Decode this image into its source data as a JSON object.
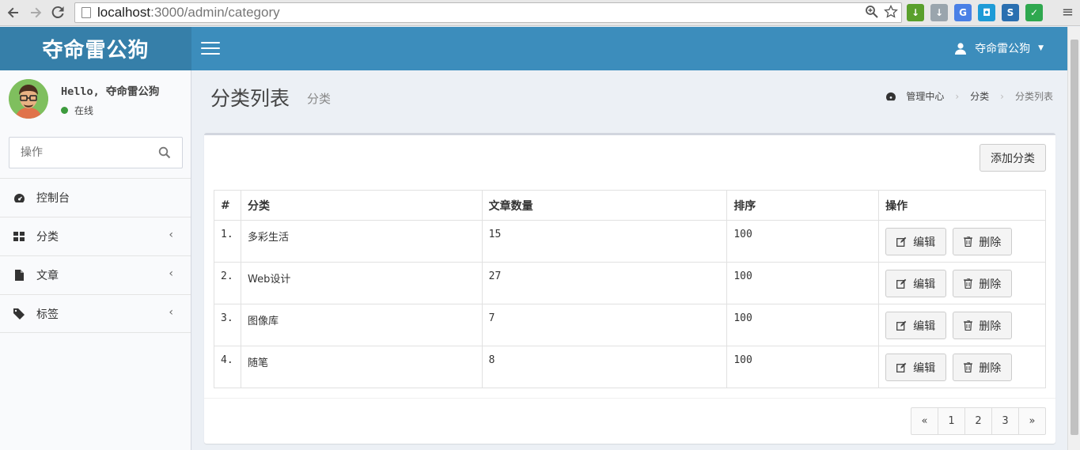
{
  "browser": {
    "url_host": "localhost",
    "url_rest": ":3000/admin/category"
  },
  "app": {
    "logo": "夺命雷公狗",
    "user_name": "夺命雷公狗"
  },
  "sidebar": {
    "hello": "Hello, 夺命雷公狗",
    "status": "在线",
    "search_placeholder": "操作",
    "items": [
      {
        "label": "控制台",
        "icon": "dashboard-icon",
        "has_children": false
      },
      {
        "label": "分类",
        "icon": "grid-icon",
        "has_children": true
      },
      {
        "label": "文章",
        "icon": "file-icon",
        "has_children": true
      },
      {
        "label": "标签",
        "icon": "tag-icon",
        "has_children": true
      }
    ]
  },
  "header": {
    "title": "分类列表",
    "subtitle": "分类",
    "breadcrumb": [
      "管理中心",
      "分类",
      "分类列表"
    ]
  },
  "box": {
    "add_label": "添加分类",
    "columns": [
      "#",
      "分类",
      "文章数量",
      "排序",
      "操作"
    ],
    "rows": [
      {
        "idx": "1.",
        "name": "多彩生活",
        "count": "15",
        "order": "100"
      },
      {
        "idx": "2.",
        "name": "Web设计",
        "count": "27",
        "order": "100"
      },
      {
        "idx": "3.",
        "name": "图像库",
        "count": "7",
        "order": "100"
      },
      {
        "idx": "4.",
        "name": "随笔",
        "count": "8",
        "order": "100"
      }
    ],
    "edit_label": "编辑",
    "delete_label": "删除",
    "pagination": [
      "«",
      "1",
      "2",
      "3",
      "»"
    ]
  },
  "colors": {
    "topbar": "#3c8dbc",
    "logo_bar": "#367fa9",
    "online": "#3d9b3d"
  }
}
